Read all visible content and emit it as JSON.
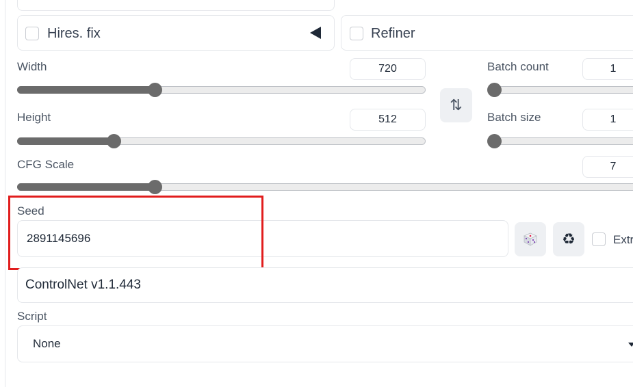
{
  "hires": {
    "label": "Hires. fix",
    "collapse_icon": "triangle-left-icon"
  },
  "refiner": {
    "label": "Refiner"
  },
  "width": {
    "label": "Width",
    "value": "720",
    "slider_fraction": 0.34
  },
  "height": {
    "label": "Height",
    "value": "512",
    "slider_fraction": 0.24
  },
  "batch_count": {
    "label": "Batch count",
    "value": "1",
    "slider_fraction": 0.0
  },
  "batch_size": {
    "label": "Batch size",
    "value": "1",
    "slider_fraction": 0.0
  },
  "cfg": {
    "label": "CFG Scale",
    "value": "7",
    "slider_fraction": 0.22
  },
  "swap_button": {
    "glyph": "⇅",
    "icon": "swap-dimensions-icon"
  },
  "seed": {
    "label": "Seed",
    "value": "2891145696",
    "random_icon": "dice-icon",
    "reuse_icon": "recycle-icon",
    "reuse_glyph": "♻",
    "extra_label": "Extra"
  },
  "controlnet": {
    "label": "ControlNet v1.1.443"
  },
  "script": {
    "label": "Script",
    "selected": "None",
    "dropdown_icon": "caret-down-icon"
  },
  "colors": {
    "highlight": "#e11d1d",
    "slider": "#6b6b6b"
  }
}
